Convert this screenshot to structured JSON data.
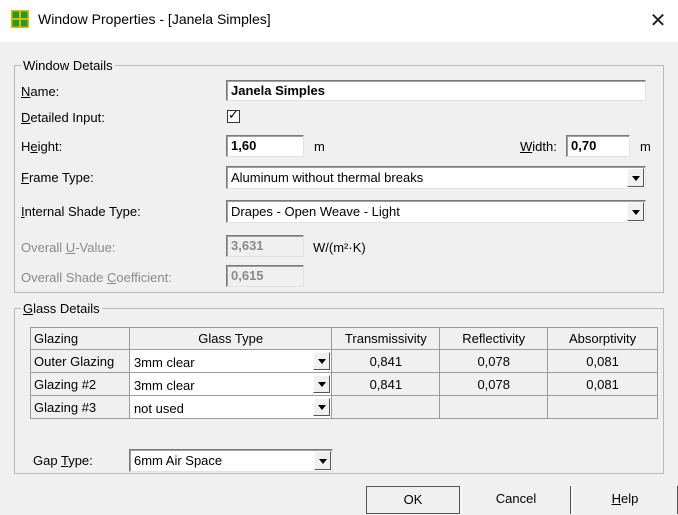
{
  "window": {
    "title": "Window Properties - [Janela Simples]",
    "close_glyph": "✕"
  },
  "window_details": {
    "legend": "Window Details",
    "name_label_pre": "",
    "name_label_u": "N",
    "name_label_post": "ame:",
    "name_value": "Janela Simples",
    "detailed_label_u": "D",
    "detailed_label_post": "etailed Input:",
    "detailed_checked": true,
    "height_label_pre": "H",
    "height_label_u": "e",
    "height_label_post": "ight:",
    "height_value": "1,60",
    "height_unit": "m",
    "width_label_u": "W",
    "width_label_post": "idth:",
    "width_value": "0,70",
    "width_unit": "m",
    "frame_label_u": "F",
    "frame_label_post": "rame Type:",
    "frame_value": "Aluminum without thermal breaks",
    "shade_label_u": "I",
    "shade_label_post": "nternal Shade Type:",
    "shade_value": "Drapes - Open Weave - Light",
    "uvalue_label_pre": "Overall ",
    "uvalue_label_u": "U",
    "uvalue_label_post": "-Value:",
    "uvalue_value": "3,631",
    "uvalue_unit": "W/(m²·K)",
    "shadecoef_label_pre": "Overall Shade ",
    "shadecoef_label_u": "C",
    "shadecoef_label_post": "oefficient:",
    "shadecoef_value": "0,615"
  },
  "glass_details": {
    "legend_u": "G",
    "legend_post": "lass Details",
    "headers": [
      "Glazing",
      "Glass Type",
      "Transmissivity",
      "Reflectivity",
      "Absorptivity"
    ],
    "rows": [
      {
        "glazing": "Outer Glazing",
        "type": "3mm clear",
        "trans": "0,841",
        "refl": "0,078",
        "abs": "0,081"
      },
      {
        "glazing": "Glazing #2",
        "type": "3mm clear",
        "trans": "0,841",
        "refl": "0,078",
        "abs": "0,081"
      },
      {
        "glazing": "Glazing #3",
        "type": "not used",
        "trans": "",
        "refl": "",
        "abs": ""
      }
    ],
    "gap_label_pre": "Gap ",
    "gap_label_u": "T",
    "gap_label_post": "ype:",
    "gap_value": "6mm Air Space"
  },
  "buttons": {
    "ok": "OK",
    "cancel": "Cancel",
    "help_u": "H",
    "help_post": "elp"
  },
  "colors": {
    "app_icon": "#1a9e2a",
    "app_icon_border": "#e9b400"
  }
}
